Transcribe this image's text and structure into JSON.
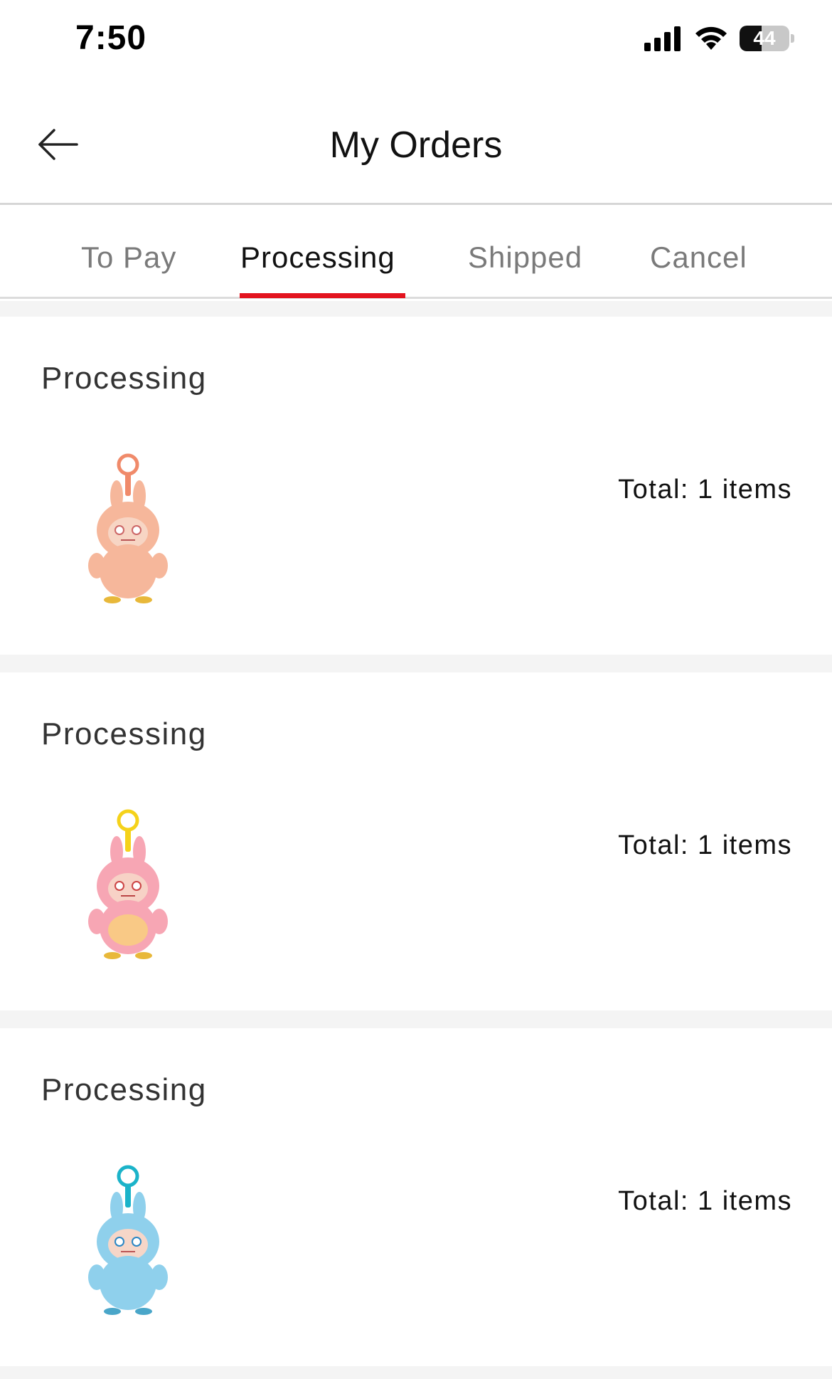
{
  "status_bar": {
    "time": "7:50",
    "battery_level": "44",
    "battery_fraction": 0.44,
    "icons": [
      "signal-icon",
      "wifi-icon",
      "battery-icon"
    ]
  },
  "header": {
    "title": "My Orders",
    "back_icon": "back-arrow-icon"
  },
  "tabs": [
    {
      "label": "To Pay",
      "active": false
    },
    {
      "label": "Processing",
      "active": true
    },
    {
      "label": "Shipped",
      "active": false
    },
    {
      "label": "Cancel",
      "active": false
    }
  ],
  "colors": {
    "accent": "#e3141f",
    "background_gap": "#f4f4f4",
    "inactive_tab": "#7a7a7a"
  },
  "orders": [
    {
      "status": "Processing",
      "total": "Total: 1 items",
      "product_color": "#f6b79b",
      "ring_color": "#f08a6a"
    },
    {
      "status": "Processing",
      "total": "Total: 1 items",
      "product_color": "#f7a6b4",
      "ring_color": "#f5d21a"
    },
    {
      "status": "Processing",
      "total": "Total: 1 items",
      "product_color": "#8fd0ec",
      "ring_color": "#1bb3c9"
    }
  ]
}
